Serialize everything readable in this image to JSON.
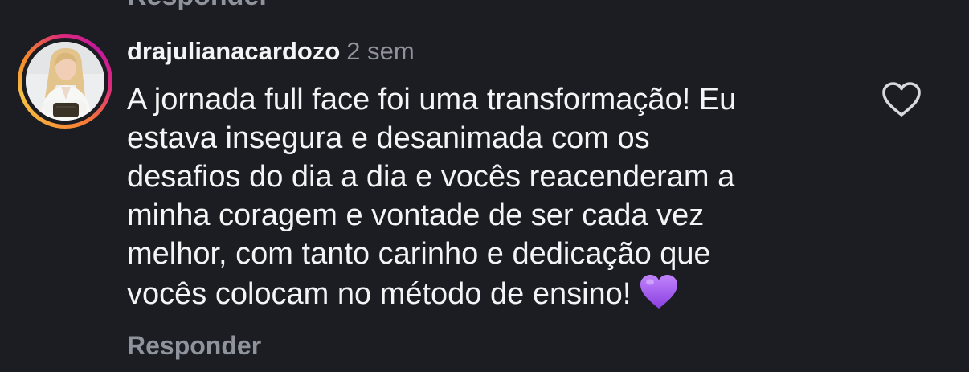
{
  "previous_comment": {
    "reply_label": "Responder"
  },
  "comment": {
    "username": "drajulianacardozo",
    "timestamp": "2 sem",
    "text_lines": [
      "A jornada full face foi uma transformação! Eu",
      "estava insegura e desanimada com os",
      "desafios do dia a dia e vocês reacenderam a",
      "minha coragem e vontade de ser cada vez",
      "melhor, com tanto carinho e dedicação que",
      "vocês colocam no método de ensino!"
    ],
    "emoji": "purple-heart",
    "reply_label": "Responder",
    "like_icon": "heart-outline-icon"
  },
  "colors": {
    "background": "#1b1d22",
    "text_primary": "#f3f4f6",
    "text_secondary": "#8e939c",
    "emoji_purple": "#a35be8"
  }
}
